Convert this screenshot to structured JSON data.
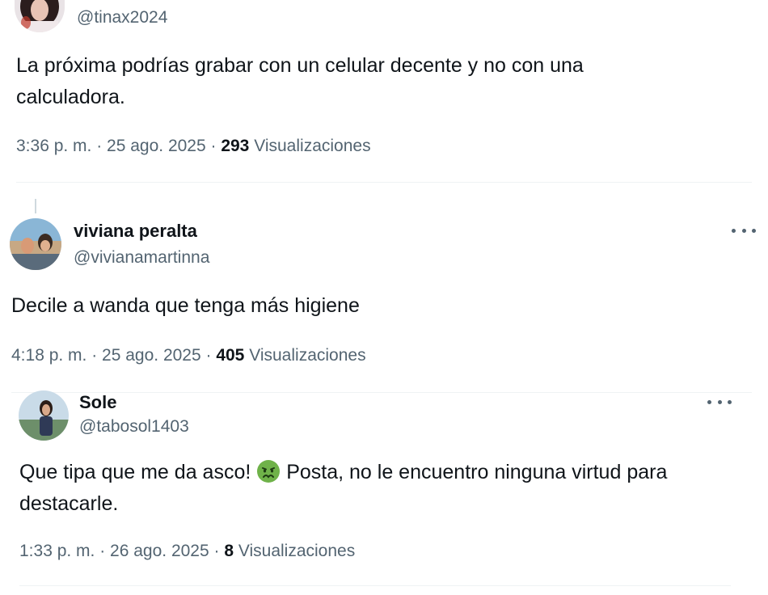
{
  "tweets": [
    {
      "handle": "@tinax2024",
      "text": "La próxima podrías grabar con un celular decente y no con una calculadora.",
      "time": "3:36 p. m. · 25 ago. 2025 · ",
      "views_count": "293",
      "views_label": " Visualizaciones"
    },
    {
      "display_name": "viviana peralta",
      "handle": "@vivianamartinna",
      "text": "Decile a wanda que tenga más higiene",
      "time": "4:18 p. m. · 25 ago. 2025 · ",
      "views_count": "405",
      "views_label": " Visualizaciones"
    },
    {
      "display_name": "Sole",
      "handle": "@tabosol1403",
      "text_before_emoji": "Que tipa que me da asco! ",
      "emoji": "nauseated-face-icon",
      "text_after_emoji": " Posta, no le encuentro ninguna virtud para destacarle.",
      "time": "1:33 p. m. · 26 ago. 2025 · ",
      "views_count": "8",
      "views_label": " Visualizaciones"
    }
  ],
  "colors": {
    "text_primary": "#0f1419",
    "text_secondary": "#536471",
    "divider": "#eff3f4",
    "emoji_green": "#6fb249"
  }
}
